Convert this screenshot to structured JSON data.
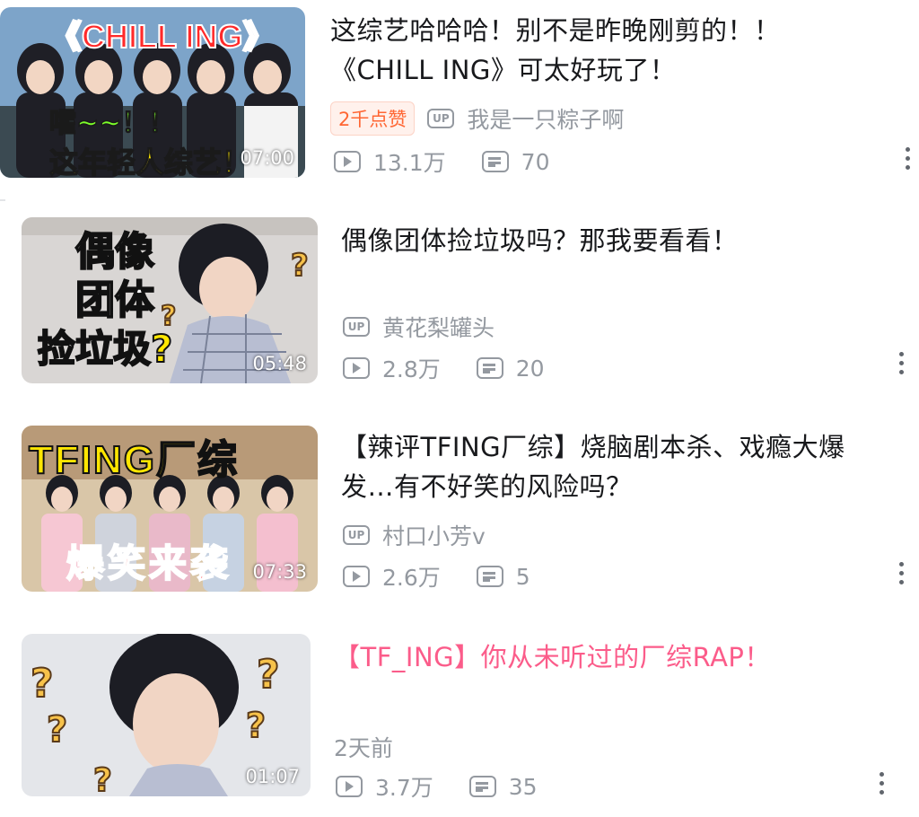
{
  "videos": [
    {
      "title": "这综艺哈哈哈！别不是昨晚刚剪的！！\n《CHILL ING》可太好玩了！",
      "title_color": "#18191c",
      "badge": "2千点赞",
      "uploader": "我是一只粽子啊",
      "duration": "07:00",
      "views": "13.1万",
      "danmaku": "70",
      "thumb_text_top": "《CHILL ING》",
      "thumb_text_mid": "嚯~~！！",
      "thumb_text_bottom": "这年轻人综艺！"
    },
    {
      "title": "偶像团体捡垃圾吗？那我要看看！",
      "title_color": "#18191c",
      "uploader": "黄花梨罐头",
      "duration": "05:48",
      "views": "2.8万",
      "danmaku": "20",
      "thumb_text_lines": [
        "偶像",
        "团体",
        "捡垃圾?"
      ]
    },
    {
      "title": "【辣评TFING厂综】烧脑剧本杀、戏瘾大爆\n发…有不好笑的风险吗？",
      "title_color": "#18191c",
      "uploader": "村口小芳v",
      "duration": "07:33",
      "views": "2.6万",
      "danmaku": "5",
      "thumb_text_top": "TFING厂综",
      "thumb_text_bottom": "爆笑来袭"
    },
    {
      "title": "【TF_ING】你从未听过的厂综RAP！",
      "title_color": "#fb5c8a",
      "time_ago": "2天前",
      "duration": "01:07",
      "views": "3.7万",
      "danmaku": "35"
    }
  ],
  "icons": {
    "up": "UP",
    "play": "play-count-icon",
    "danmaku": "danmaku-icon",
    "more": "more-vertical-icon"
  }
}
